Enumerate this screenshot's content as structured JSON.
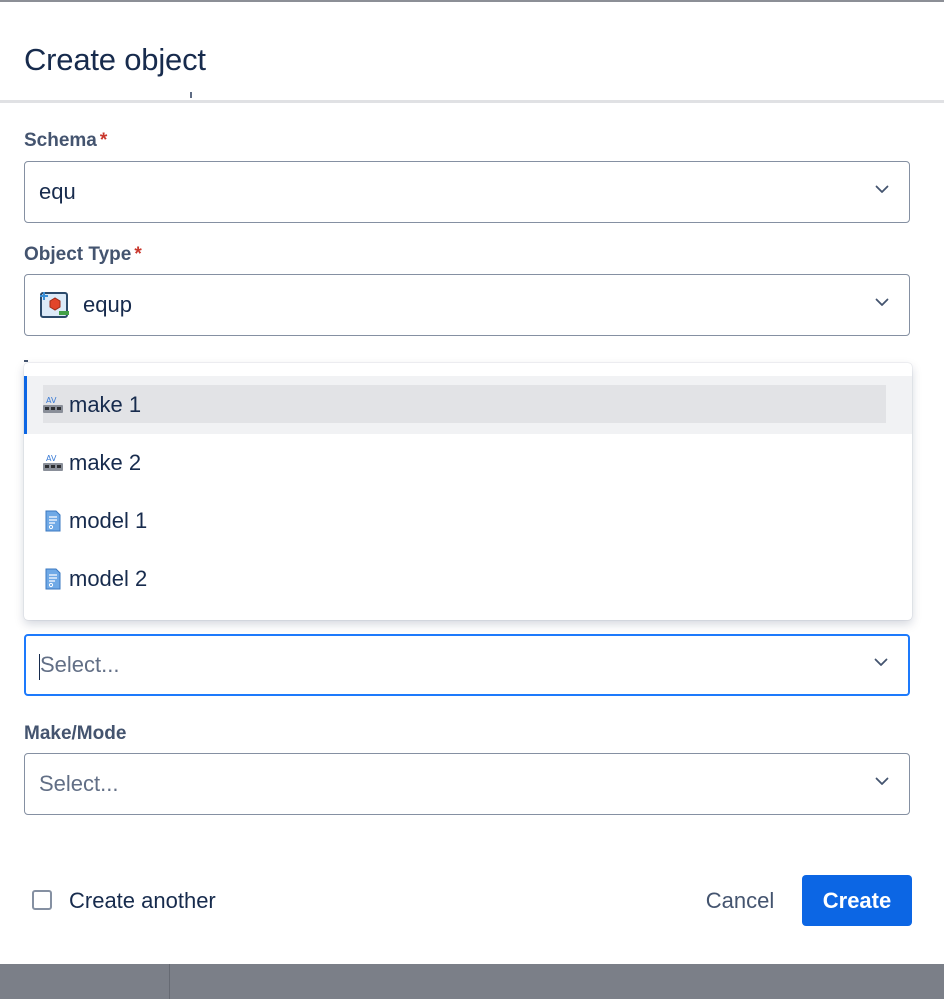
{
  "dialog": {
    "title": "Create object"
  },
  "fields": {
    "schema": {
      "label": "Schema",
      "required": "*",
      "value": "equ"
    },
    "object_type": {
      "label": "Object Type",
      "required": "*",
      "value": "equp",
      "icon": "cube-object-icon"
    },
    "selector": {
      "placeholder": "Select..."
    },
    "make_mode": {
      "label": "Make/Mode",
      "placeholder": "Select..."
    }
  },
  "dropdown": {
    "items": [
      {
        "label": "make 1",
        "icon": "av-device-icon",
        "selected": true
      },
      {
        "label": "make 2",
        "icon": "av-device-icon",
        "selected": false
      },
      {
        "label": "model 1",
        "icon": "document-icon",
        "selected": false
      },
      {
        "label": "model 2",
        "icon": "document-icon",
        "selected": false
      }
    ]
  },
  "footer": {
    "create_another_label": "Create another",
    "cancel_label": "Cancel",
    "create_label": "Create"
  },
  "colors": {
    "accent": "#0c66e4",
    "focus_border": "#1d7afc",
    "required": "#c9372c"
  }
}
